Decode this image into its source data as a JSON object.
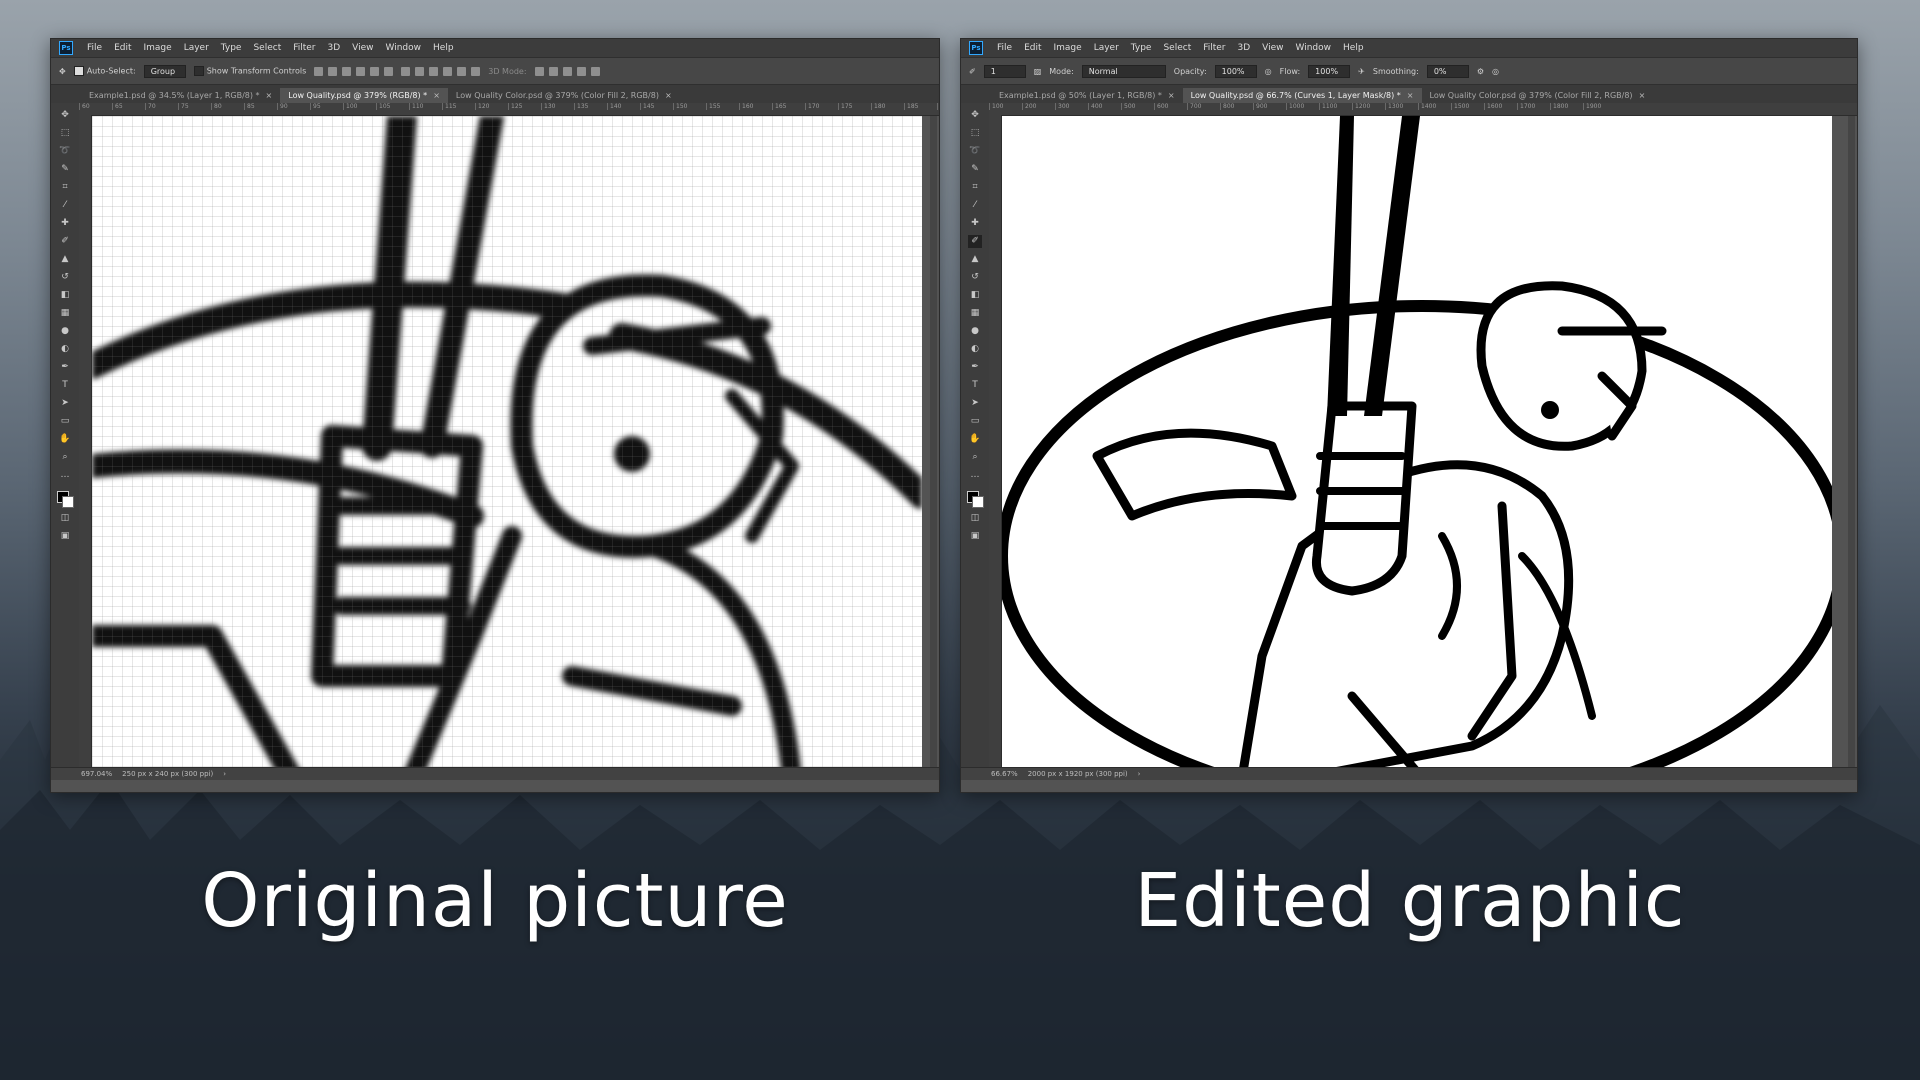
{
  "menu": [
    "File",
    "Edit",
    "Image",
    "Layer",
    "Type",
    "Select",
    "Filter",
    "3D",
    "View",
    "Window",
    "Help"
  ],
  "left": {
    "options": {
      "auto_select_label": "Auto-Select:",
      "auto_select_value": "Group",
      "transform_label": "Show Transform Controls",
      "mode_3d": "3D Mode:"
    },
    "tabs": [
      {
        "label": "Example1.psd @ 34.5% (Layer 1, RGB/8) *"
      },
      {
        "label": "Low Quality.psd @ 379% (RGB/8) *"
      },
      {
        "label": "Low Quality Color.psd @ 379% (Color Fill 2, RGB/8)"
      }
    ],
    "ruler": [
      "60",
      "65",
      "70",
      "75",
      "80",
      "85",
      "90",
      "95",
      "100",
      "105",
      "110",
      "115",
      "120",
      "125",
      "130",
      "135",
      "140",
      "145",
      "150",
      "155",
      "160",
      "165",
      "170",
      "175",
      "180",
      "185",
      "190",
      "195",
      "200",
      "205",
      "210",
      "215"
    ],
    "status_zoom": "697.04%",
    "status_doc": "250 px x 240 px (300 ppi)"
  },
  "right": {
    "options": {
      "mode_label": "Mode:",
      "mode_value": "Normal",
      "opacity_label": "Opacity:",
      "opacity_value": "100%",
      "flow_label": "Flow:",
      "flow_value": "100%",
      "smoothing_label": "Smoothing:",
      "smoothing_value": "0%",
      "brush_size": "1"
    },
    "tabs": [
      {
        "label": "Example1.psd @ 50% (Layer 1, RGB/8) *"
      },
      {
        "label": "Low Quality.psd @ 66.7% (Curves 1, Layer Mask/8) *"
      },
      {
        "label": "Low Quality Color.psd @ 379% (Color Fill 2, RGB/8)"
      }
    ],
    "ruler": [
      "100",
      "200",
      "300",
      "400",
      "500",
      "600",
      "700",
      "800",
      "900",
      "1000",
      "1100",
      "1200",
      "1300",
      "1400",
      "1500",
      "1600",
      "1700",
      "1800",
      "1900"
    ],
    "status_zoom": "66.67%",
    "status_doc": "2000 px x 1920 px (300 ppi)"
  },
  "captions": {
    "left": "Original picture",
    "right": "Edited graphic"
  },
  "colors": {
    "accent": "#31a8ff",
    "panel": "#535353",
    "menubar": "#3c3c3c"
  }
}
